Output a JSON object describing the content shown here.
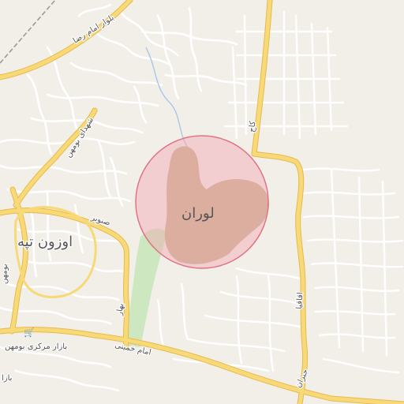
{
  "map": {
    "colors": {
      "background": "#f2efe9",
      "major_road": "#f7d978",
      "major_road_casing": "#e8b94e",
      "minor_road": "#ffffff",
      "minor_road_casing": "#d8d4cc",
      "park": "#cde8c0",
      "built_area": "#c8b591",
      "highlight_fill": "#f3a6b2",
      "highlight_stroke": "#e07585",
      "water": "#a8c8e8",
      "rail": "#9a9a9a"
    },
    "highlight": {
      "label": "لوران"
    },
    "district_label": "اوزون تپه",
    "streets": [
      {
        "id": "imam-reza",
        "label": "بلوار امام رضا"
      },
      {
        "id": "shohada-bumahen",
        "label": "شهدای بومهن"
      },
      {
        "id": "senobar",
        "label": "صنوبر"
      },
      {
        "id": "bahar",
        "label": "بهار"
      },
      {
        "id": "imam-khomeini",
        "label": "امام خمینی"
      },
      {
        "id": "kaj",
        "label": "کاج"
      },
      {
        "id": "aghagia",
        "label": "اقاقیا"
      },
      {
        "id": "jebran",
        "label": "جبران"
      },
      {
        "id": "bumahen-west",
        "label": "بومهن"
      },
      {
        "id": "bazar",
        "label": "بازا"
      }
    ],
    "poi": [
      {
        "id": "bazar-markazi",
        "label": "بازار مرکزی بومهن",
        "icon": "shopping-cart-icon"
      }
    ]
  }
}
